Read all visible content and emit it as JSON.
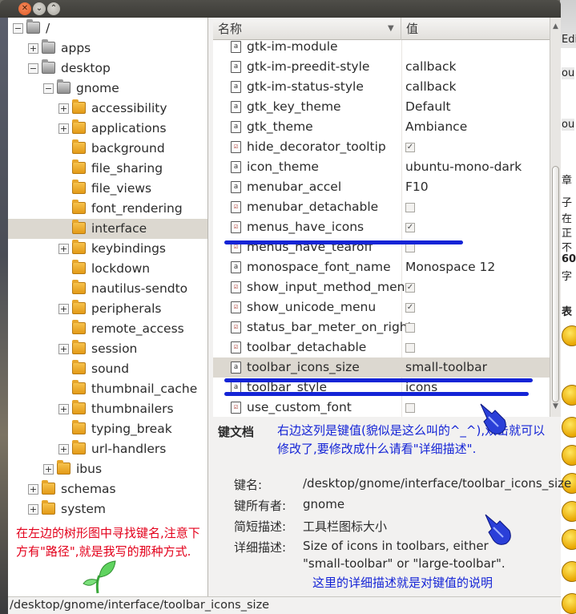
{
  "columns": {
    "name": "名称",
    "value": "值"
  },
  "tree": [
    {
      "label": "/",
      "depth": 0,
      "expander": "−",
      "folder": "grey"
    },
    {
      "label": "apps",
      "depth": 1,
      "expander": "+",
      "folder": "grey"
    },
    {
      "label": "desktop",
      "depth": 1,
      "expander": "−",
      "folder": "grey"
    },
    {
      "label": "gnome",
      "depth": 2,
      "expander": "−",
      "folder": "grey"
    },
    {
      "label": "accessibility",
      "depth": 3,
      "expander": "+",
      "folder": "yellow"
    },
    {
      "label": "applications",
      "depth": 3,
      "expander": "+",
      "folder": "yellow"
    },
    {
      "label": "background",
      "depth": 3,
      "expander": "",
      "folder": "yellow"
    },
    {
      "label": "file_sharing",
      "depth": 3,
      "expander": "",
      "folder": "yellow"
    },
    {
      "label": "file_views",
      "depth": 3,
      "expander": "",
      "folder": "yellow"
    },
    {
      "label": "font_rendering",
      "depth": 3,
      "expander": "",
      "folder": "yellow"
    },
    {
      "label": "interface",
      "depth": 3,
      "expander": "",
      "folder": "yellow",
      "selected": true
    },
    {
      "label": "keybindings",
      "depth": 3,
      "expander": "+",
      "folder": "yellow"
    },
    {
      "label": "lockdown",
      "depth": 3,
      "expander": "",
      "folder": "yellow"
    },
    {
      "label": "nautilus-sendto",
      "depth": 3,
      "expander": "",
      "folder": "yellow"
    },
    {
      "label": "peripherals",
      "depth": 3,
      "expander": "+",
      "folder": "yellow"
    },
    {
      "label": "remote_access",
      "depth": 3,
      "expander": "",
      "folder": "yellow"
    },
    {
      "label": "session",
      "depth": 3,
      "expander": "+",
      "folder": "yellow"
    },
    {
      "label": "sound",
      "depth": 3,
      "expander": "",
      "folder": "yellow"
    },
    {
      "label": "thumbnail_cache",
      "depth": 3,
      "expander": "",
      "folder": "yellow"
    },
    {
      "label": "thumbnailers",
      "depth": 3,
      "expander": "+",
      "folder": "yellow"
    },
    {
      "label": "typing_break",
      "depth": 3,
      "expander": "",
      "folder": "yellow"
    },
    {
      "label": "url-handlers",
      "depth": 3,
      "expander": "+",
      "folder": "yellow"
    },
    {
      "label": "ibus",
      "depth": 2,
      "expander": "+",
      "folder": "yellow"
    },
    {
      "label": "schemas",
      "depth": 1,
      "expander": "+",
      "folder": "yellow"
    },
    {
      "label": "system",
      "depth": 1,
      "expander": "+",
      "folder": "yellow"
    }
  ],
  "keys": [
    {
      "name": "gtk-im-module",
      "type": "string",
      "value": ""
    },
    {
      "name": "gtk-im-preedit-style",
      "type": "string",
      "value": "callback"
    },
    {
      "name": "gtk-im-status-style",
      "type": "string",
      "value": "callback"
    },
    {
      "name": "gtk_key_theme",
      "type": "string",
      "value": "Default"
    },
    {
      "name": "gtk_theme",
      "type": "string",
      "value": "Ambiance"
    },
    {
      "name": "hide_decorator_tooltip",
      "type": "bool",
      "checked": true
    },
    {
      "name": "icon_theme",
      "type": "string",
      "value": "ubuntu-mono-dark"
    },
    {
      "name": "menubar_accel",
      "type": "string",
      "value": "F10"
    },
    {
      "name": "menubar_detachable",
      "type": "bool",
      "checked": false
    },
    {
      "name": "menus_have_icons",
      "type": "bool",
      "checked": true
    },
    {
      "name": "menus_have_tearoff",
      "type": "bool",
      "checked": false
    },
    {
      "name": "monospace_font_name",
      "type": "string",
      "value": "Monospace 12"
    },
    {
      "name": "show_input_method_menu",
      "type": "bool",
      "checked": true
    },
    {
      "name": "show_unicode_menu",
      "type": "bool",
      "checked": true
    },
    {
      "name": "status_bar_meter_on_right",
      "type": "bool",
      "checked": false
    },
    {
      "name": "toolbar_detachable",
      "type": "bool",
      "checked": false
    },
    {
      "name": "toolbar_icons_size",
      "type": "string",
      "value": "small-toolbar",
      "selected": true
    },
    {
      "name": "toolbar_style",
      "type": "string",
      "value": "icons"
    },
    {
      "name": "use_custom_font",
      "type": "bool",
      "checked": false
    }
  ],
  "doc": {
    "title": "键文档",
    "key_name_label": "键名:",
    "key_name": "/desktop/gnome/interface/toolbar_icons_size",
    "owner_label": "键所有者:",
    "owner": "gnome",
    "short_label": "简短描述:",
    "short": "工具栏图标大小",
    "long_label": "详细描述:",
    "long": "Size of icons in toolbars, either \"small-toolbar\" or \"large-toolbar\"."
  },
  "annotations": {
    "top": "右边这列是键值(貌似是这么叫的^_^),双击就可以修改了,要修改成什么请看\"详细描述\".",
    "left": "在左边的树形图中寻找键名,注意下方有\"路径\",就是我写的那种方式.",
    "bottom": "这里的详细描述就是对键值的说明"
  },
  "status_path": "/desktop/gnome/interface/toolbar_icons_size",
  "desktop_fragments": [
    "Edi",
    "ou",
    "ou",
    "章",
    "子",
    "在",
    "正",
    "不",
    "60",
    "字",
    "表"
  ],
  "colors": {
    "annotation_red": "#e3001b",
    "annotation_blue": "#1424d6",
    "selection": "#dcd8d0"
  }
}
